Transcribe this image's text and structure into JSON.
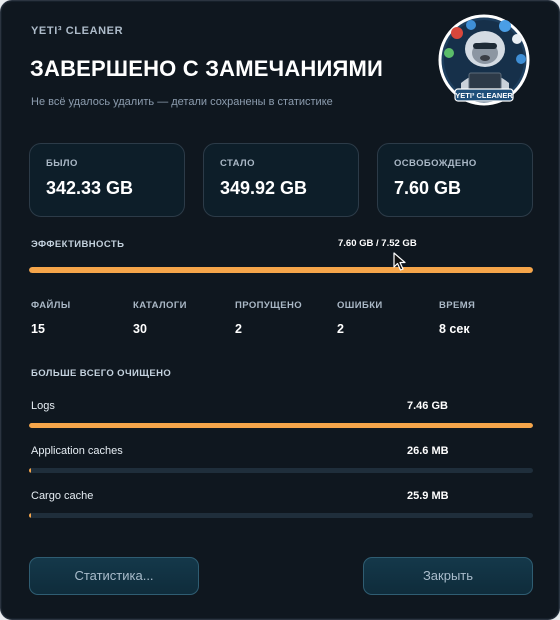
{
  "header": {
    "app_name": "YETI³ CLEANER",
    "title": "ЗАВЕРШЕНО С ЗАМЕЧАНИЯМИ",
    "subtitle": "Не всё удалось удалить — детали сохранены в статистике",
    "logo_text": "YETI³ CLEANER"
  },
  "summary": [
    {
      "label": "БЫЛО",
      "value": "342.33 GB"
    },
    {
      "label": "СТАЛО",
      "value": "349.92 GB"
    },
    {
      "label": "ОСВОБОЖДЕНО",
      "value": "7.60 GB"
    }
  ],
  "efficiency": {
    "label": "ЭФФЕКТИВНОСТЬ",
    "value_text": "7.60 GB / 7.52 GB",
    "fill_fraction": 1.0
  },
  "stats": [
    {
      "label": "ФАЙЛЫ",
      "value": "15"
    },
    {
      "label": "КАТАЛОГИ",
      "value": "30"
    },
    {
      "label": "ПРОПУЩЕНО",
      "value": "2"
    },
    {
      "label": "ОШИБКИ",
      "value": "2"
    },
    {
      "label": "ВРЕМЯ",
      "value": "8 сек"
    }
  ],
  "top_cleaned": {
    "title": "БОЛЬШЕ ВСЕГО ОЧИЩЕНО",
    "items": [
      {
        "name": "Logs",
        "size": "7.46 GB",
        "fill_fraction": 1.0
      },
      {
        "name": "Application caches",
        "size": "26.6 MB",
        "fill_fraction": 0.004
      },
      {
        "name": "Cargo cache",
        "size": "25.9 MB",
        "fill_fraction": 0.004
      }
    ]
  },
  "buttons": {
    "stats_label": "Статистика...",
    "close_label": "Закрыть"
  },
  "colors": {
    "accent": "#f5a54a",
    "background": "#0f171f",
    "card": "#0d1e29",
    "button": "#14384a"
  },
  "icons": {
    "logo": "yeti-logo-icon",
    "cursor": "mouse-pointer-icon"
  }
}
